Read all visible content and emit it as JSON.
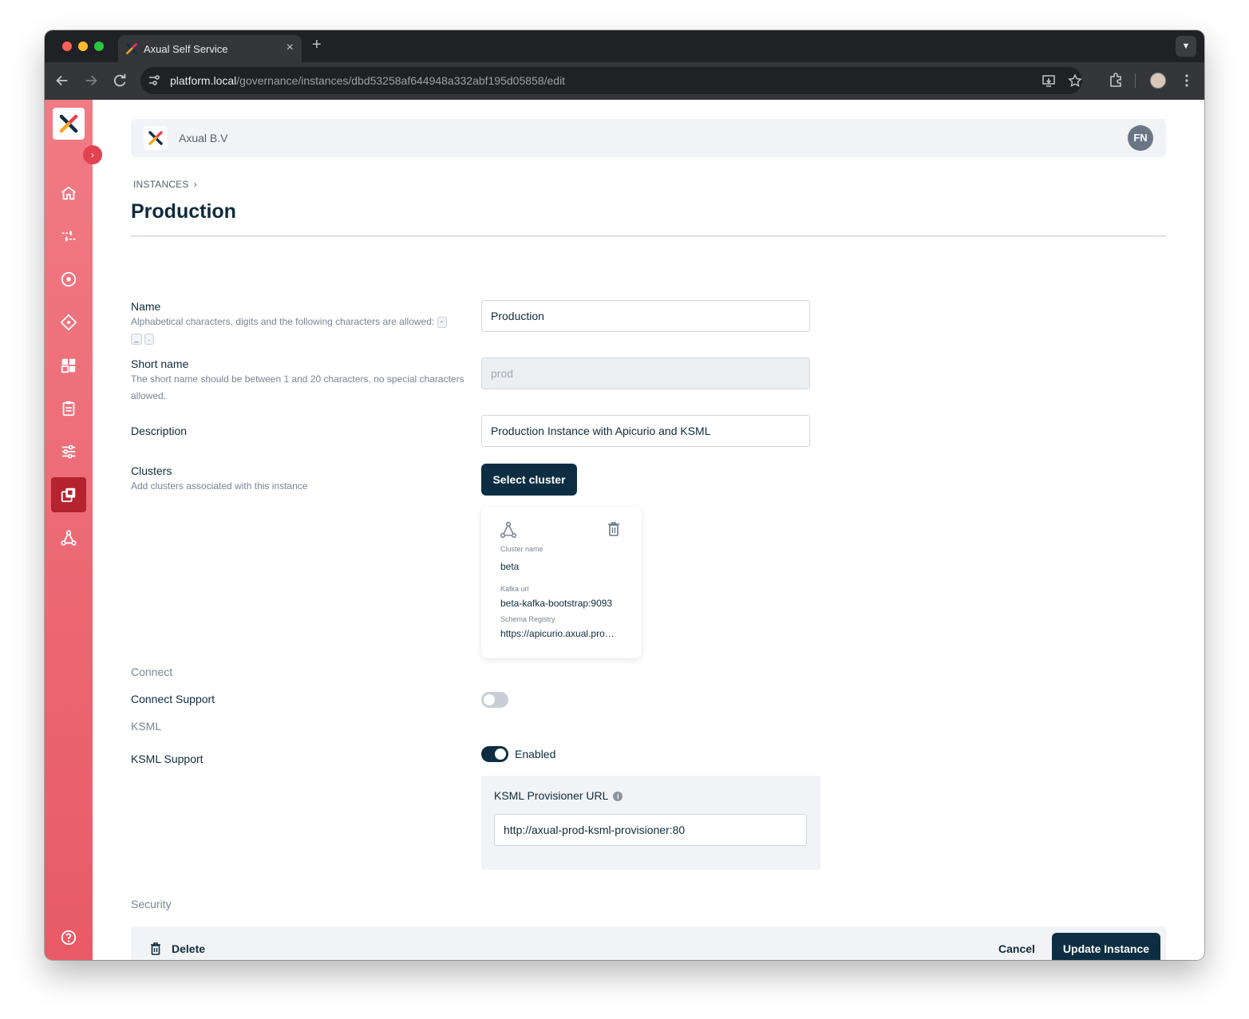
{
  "browser": {
    "tab_title": "Axual Self Service",
    "tab_close": "×",
    "new_tab": "+",
    "url_host": "platform.local",
    "url_path": "/governance/instances/dbd53258af644948a332abf195d05858/edit"
  },
  "header": {
    "org_name": "Axual B.V",
    "user_initials": "FN"
  },
  "breadcrumb": {
    "root": "INSTANCES",
    "separator": "›"
  },
  "page": {
    "title": "Production"
  },
  "form": {
    "name": {
      "label": "Name",
      "help": "Alphabetical characters, digits and the following characters are allowed:",
      "allowed_chars": [
        "-",
        "_",
        "."
      ],
      "value": "Production"
    },
    "short_name": {
      "label": "Short name",
      "help": "The short name should be between 1 and 20 characters, no special characters allowed.",
      "value": "prod"
    },
    "description": {
      "label": "Description",
      "value": "Production Instance with Apicurio and KSML"
    },
    "clusters": {
      "label": "Clusters",
      "help": "Add clusters associated with this instance",
      "button": "Select cluster",
      "cards": [
        {
          "name_label": "Cluster name",
          "name": "beta",
          "kafka_label": "Kafka url",
          "kafka_url": "beta-kafka-bootstrap:9093",
          "schema_label": "Schema Registry",
          "schema_url": "https://apicurio.axual.pro…"
        }
      ]
    },
    "connect": {
      "section": "Connect",
      "label": "Connect Support",
      "enabled": false
    },
    "ksml": {
      "section": "KSML",
      "label": "KSML Support",
      "enabled": true,
      "status": "Enabled",
      "provisioner_label": "KSML Provisioner URL",
      "info": "i",
      "provisioner_url": "http://axual-prod-ksml-provisioner:80"
    },
    "security": {
      "section": "Security"
    }
  },
  "footer": {
    "delete": "Delete",
    "cancel": "Cancel",
    "update": "Update Instance"
  },
  "colors": {
    "sidebar_top": "#f17b85",
    "sidebar_bottom": "#e85a66",
    "sidebar_active": "#b5232f",
    "primary": "#0d2e42",
    "title": "#0f2b3c"
  },
  "icons": {
    "sidebar": [
      "home-icon",
      "streams-icon",
      "target-icon",
      "diamond-icon",
      "dashboard-icon",
      "clipboard-icon",
      "sliders-icon",
      "instances-icon",
      "clusters-icon",
      "help-icon"
    ]
  }
}
